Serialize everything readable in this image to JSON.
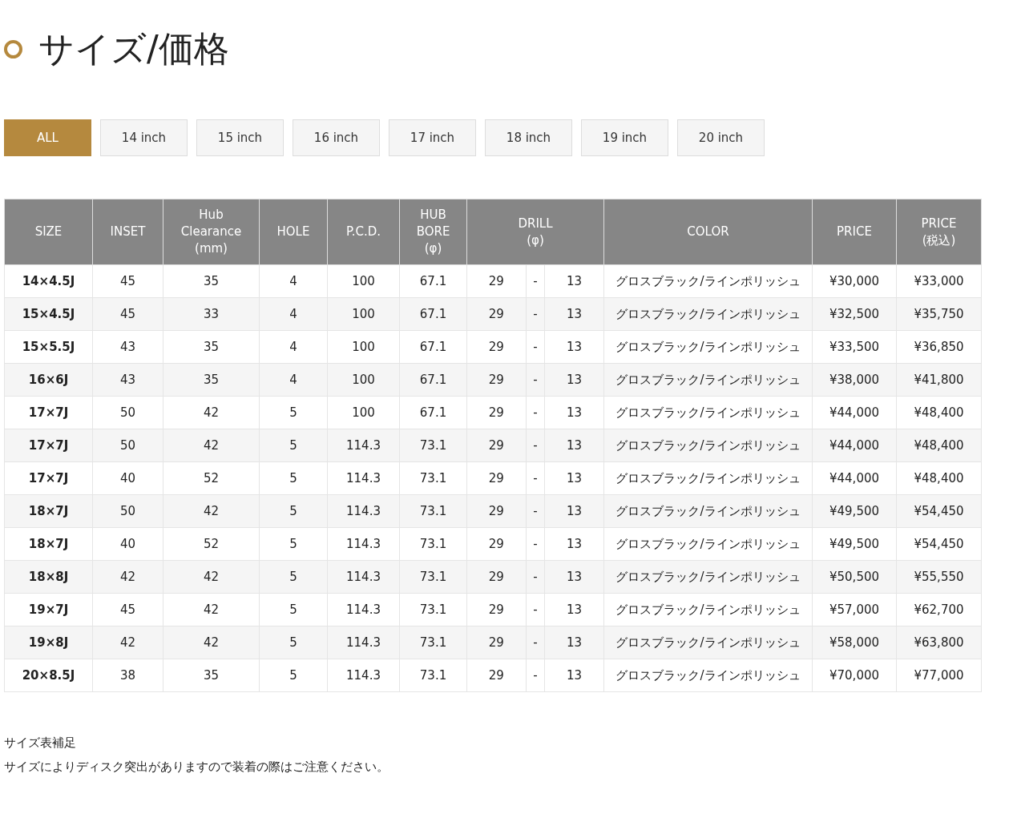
{
  "title": "サイズ/価格",
  "filters": [
    {
      "label": "ALL",
      "selected": true
    },
    {
      "label": "14 inch",
      "selected": false
    },
    {
      "label": "15 inch",
      "selected": false
    },
    {
      "label": "16 inch",
      "selected": false
    },
    {
      "label": "17 inch",
      "selected": false
    },
    {
      "label": "18 inch",
      "selected": false
    },
    {
      "label": "19 inch",
      "selected": false
    },
    {
      "label": "20 inch",
      "selected": false
    }
  ],
  "table": {
    "columns": {
      "size": "SIZE",
      "inset": "INSET",
      "hub_clearance": "Hub\nClearance\n(mm)",
      "hole": "HOLE",
      "pcd": "P.C.D.",
      "hub_bore": "HUB\nBORE\n(φ)",
      "drill": "DRILL\n(φ)",
      "finish": "COLOR",
      "price": "PRICE",
      "price_tax": "PRICE\n(税込)"
    },
    "rows": [
      {
        "size": "14×4.5J",
        "inset": "45",
        "hub_clearance": "35",
        "hole": "4",
        "pcd": "100",
        "hub_bore": "67.1",
        "drill": [
          "29",
          "-",
          "13"
        ],
        "finish": "グロスブラック/ラインポリッシュ",
        "price": "¥30,000",
        "price_tax": "¥33,000"
      },
      {
        "size": "15×4.5J",
        "inset": "45",
        "hub_clearance": "33",
        "hole": "4",
        "pcd": "100",
        "hub_bore": "67.1",
        "drill": [
          "29",
          "-",
          "13"
        ],
        "finish": "グロスブラック/ラインポリッシュ",
        "price": "¥32,500",
        "price_tax": "¥35,750"
      },
      {
        "size": "15×5.5J",
        "inset": "43",
        "hub_clearance": "35",
        "hole": "4",
        "pcd": "100",
        "hub_bore": "67.1",
        "drill": [
          "29",
          "-",
          "13"
        ],
        "finish": "グロスブラック/ラインポリッシュ",
        "price": "¥33,500",
        "price_tax": "¥36,850"
      },
      {
        "size": "16×6J",
        "inset": "43",
        "hub_clearance": "35",
        "hole": "4",
        "pcd": "100",
        "hub_bore": "67.1",
        "drill": [
          "29",
          "-",
          "13"
        ],
        "finish": "グロスブラック/ラインポリッシュ",
        "price": "¥38,000",
        "price_tax": "¥41,800"
      },
      {
        "size": "17×7J",
        "inset": "50",
        "hub_clearance": "42",
        "hole": "5",
        "pcd": "100",
        "hub_bore": "67.1",
        "drill": [
          "29",
          "-",
          "13"
        ],
        "finish": "グロスブラック/ラインポリッシュ",
        "price": "¥44,000",
        "price_tax": "¥48,400"
      },
      {
        "size": "17×7J",
        "inset": "50",
        "hub_clearance": "42",
        "hole": "5",
        "pcd": "114.3",
        "hub_bore": "73.1",
        "drill": [
          "29",
          "-",
          "13"
        ],
        "finish": "グロスブラック/ラインポリッシュ",
        "price": "¥44,000",
        "price_tax": "¥48,400"
      },
      {
        "size": "17×7J",
        "inset": "40",
        "hub_clearance": "52",
        "hole": "5",
        "pcd": "114.3",
        "hub_bore": "73.1",
        "drill": [
          "29",
          "-",
          "13"
        ],
        "finish": "グロスブラック/ラインポリッシュ",
        "price": "¥44,000",
        "price_tax": "¥48,400"
      },
      {
        "size": "18×7J",
        "inset": "50",
        "hub_clearance": "42",
        "hole": "5",
        "pcd": "114.3",
        "hub_bore": "73.1",
        "drill": [
          "29",
          "-",
          "13"
        ],
        "finish": "グロスブラック/ラインポリッシュ",
        "price": "¥49,500",
        "price_tax": "¥54,450"
      },
      {
        "size": "18×7J",
        "inset": "40",
        "hub_clearance": "52",
        "hole": "5",
        "pcd": "114.3",
        "hub_bore": "73.1",
        "drill": [
          "29",
          "-",
          "13"
        ],
        "finish": "グロスブラック/ラインポリッシュ",
        "price": "¥49,500",
        "price_tax": "¥54,450"
      },
      {
        "size": "18×8J",
        "inset": "42",
        "hub_clearance": "42",
        "hole": "5",
        "pcd": "114.3",
        "hub_bore": "73.1",
        "drill": [
          "29",
          "-",
          "13"
        ],
        "finish": "グロスブラック/ラインポリッシュ",
        "price": "¥50,500",
        "price_tax": "¥55,550"
      },
      {
        "size": "19×7J",
        "inset": "45",
        "hub_clearance": "42",
        "hole": "5",
        "pcd": "114.3",
        "hub_bore": "73.1",
        "drill": [
          "29",
          "-",
          "13"
        ],
        "finish": "グロスブラック/ラインポリッシュ",
        "price": "¥57,000",
        "price_tax": "¥62,700"
      },
      {
        "size": "19×8J",
        "inset": "42",
        "hub_clearance": "42",
        "hole": "5",
        "pcd": "114.3",
        "hub_bore": "73.1",
        "drill": [
          "29",
          "-",
          "13"
        ],
        "finish": "グロスブラック/ラインポリッシュ",
        "price": "¥58,000",
        "price_tax": "¥63,800"
      },
      {
        "size": "20×8.5J",
        "inset": "38",
        "hub_clearance": "35",
        "hole": "5",
        "pcd": "114.3",
        "hub_bore": "73.1",
        "drill": [
          "29",
          "-",
          "13"
        ],
        "finish": "グロスブラック/ラインポリッシュ",
        "price": "¥70,000",
        "price_tax": "¥77,000"
      }
    ]
  },
  "notes": {
    "title": "サイズ表補足",
    "text": "サイズによりディスク突出がありますので装着の際はご注意ください。"
  }
}
